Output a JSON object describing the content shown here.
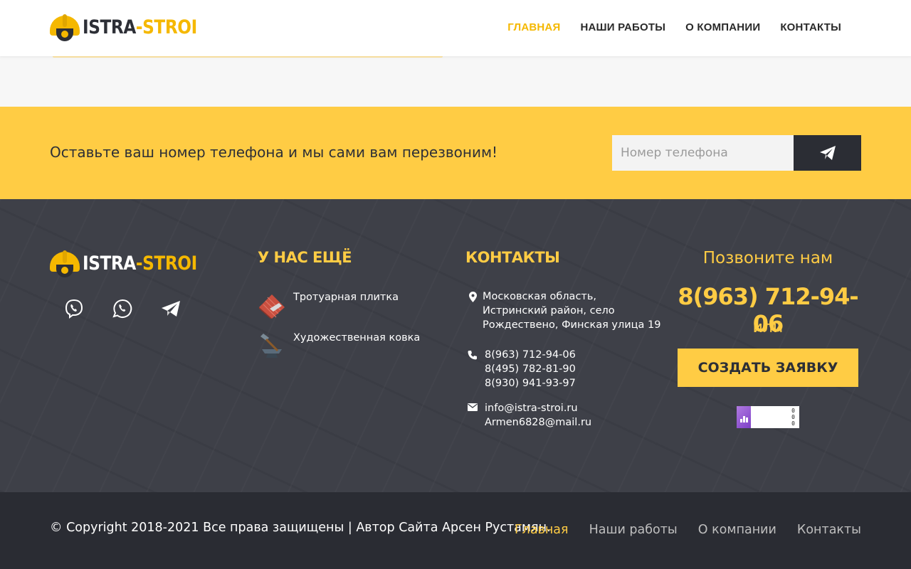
{
  "header": {
    "logo_part1": "ISTRA",
    "logo_part2": "-STROI",
    "nav": [
      {
        "label": "ГЛАВНАЯ",
        "active": true
      },
      {
        "label": "НАШИ РАБОТЫ",
        "active": false
      },
      {
        "label": "О КОМПАНИИ",
        "active": false
      },
      {
        "label": "КОНТАКТЫ",
        "active": false
      }
    ]
  },
  "callback": {
    "text": "Оставьте ваш номер телефона и мы сами вам перезвоним!",
    "placeholder": "Номер телефона",
    "send_icon": "paper-plane-icon"
  },
  "footer": {
    "socials": [
      "viber-icon",
      "whatsapp-icon",
      "telegram-icon"
    ],
    "more_title": "У НАС ЕЩЁ",
    "more_items": [
      {
        "label": "Тротуарная плитка",
        "icon": "paving-tile-icon"
      },
      {
        "label": "Художественная ковка",
        "icon": "anvil-hammer-icon"
      }
    ],
    "contacts_title": "КОНТАКТЫ",
    "address": [
      "Московская область,",
      "Истринский район, село",
      "Рождествено, Финская улица 19"
    ],
    "phones": [
      "8(963) 712-94-06",
      "8(495) 782-81-90",
      "8(930) 941-93-97"
    ],
    "emails": [
      "info@istra-stroi.ru",
      "Armen6828@mail.ru"
    ],
    "call_title": "Позвоните нам",
    "call_phone": "8(963) 712-94-06",
    "call_or": "или",
    "order_button": "СОЗДАТЬ ЗАЯВКУ",
    "counter_values": [
      "0",
      "0",
      "0"
    ]
  },
  "bottom": {
    "copyright": "© Copyright 2018-2021 Все права защищены | Автор Сайта Арсен Рустамян.",
    "nav": [
      {
        "label": "Главная",
        "active": true
      },
      {
        "label": "Наши работы",
        "active": false
      },
      {
        "label": "О компании",
        "active": false
      },
      {
        "label": "Контакты",
        "active": false
      }
    ]
  },
  "colors": {
    "accent": "#ffcc44",
    "dark": "#2d2f36",
    "footer_bg": "#3e4048",
    "bottom_bg": "#2a2c33"
  }
}
